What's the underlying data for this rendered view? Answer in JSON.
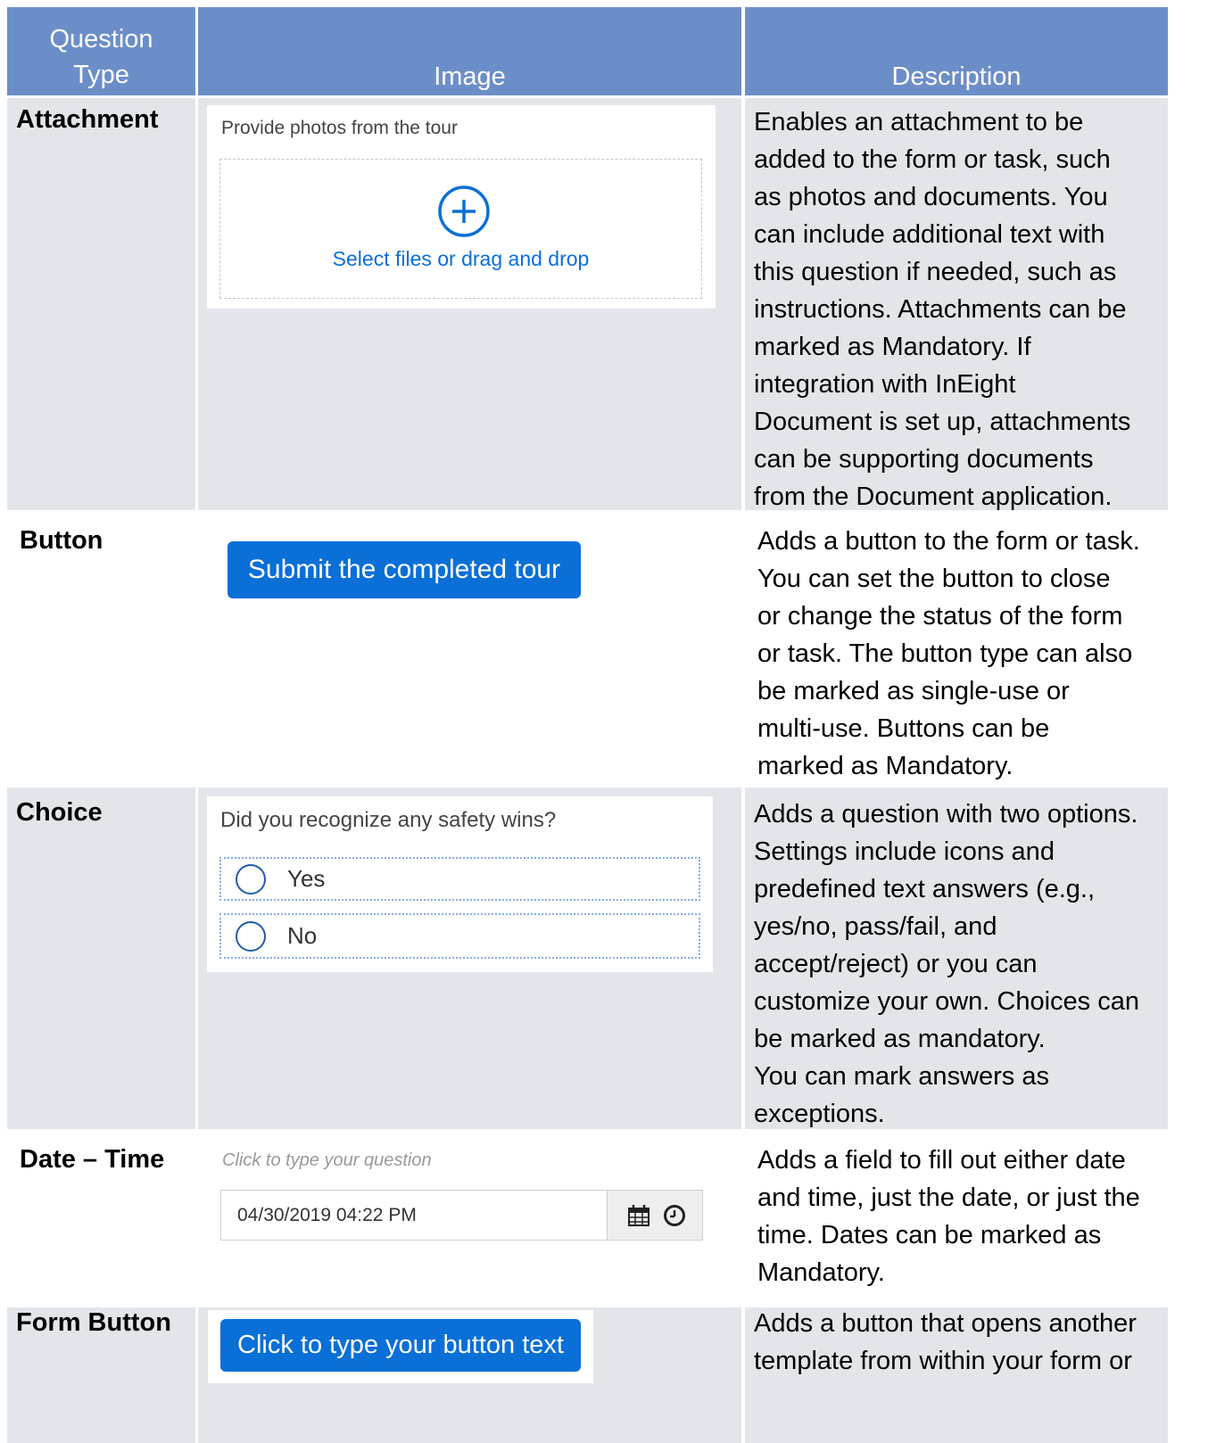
{
  "headers": {
    "question_type": "Question\nType",
    "image": "Image",
    "description": "Description"
  },
  "rows": [
    {
      "type": "Attachment",
      "description": "Enables an attachment to be\nadded to the form or task, such\nas photos and documents. You\ncan include additional text with\nthis question if needed, such as\ninstructions. Attachments can be\nmarked as Mandatory. If\nintegration with InEight\nDocument is set up, attachments\ncan be supporting documents\nfrom the Document application."
    },
    {
      "type": "Button",
      "description": "Adds a button to the form or task.\nYou can set the button to close\nor change the status of the form\nor task. The button type can also\nbe marked as single-use or\nmulti-use. Buttons can be\nmarked as Mandatory."
    },
    {
      "type": "Choice",
      "description": "Adds a question with two options.\nSettings include icons and\npredefined text answers (e.g.,\nyes/no, pass/fail, and\naccept/reject) or you can\ncustomize your own. Choices can\nbe marked as mandatory.\nYou can mark answers as\nexceptions."
    },
    {
      "type": "Date – Time",
      "description": "Adds a field to fill out either date\nand time, just the date, or just the\ntime. Dates can be marked as\nMandatory."
    },
    {
      "type": "Form Button",
      "description": "Adds a button that opens another\ntemplate from within your form or"
    }
  ],
  "attachment_widget": {
    "prompt": "Provide photos from the tour",
    "action": "Select files or drag and drop",
    "icon": "plus-circle-icon"
  },
  "button_widget": {
    "label": "Submit the completed tour"
  },
  "choice_widget": {
    "question": "Did you recognize any safety wins?",
    "options": [
      "Yes",
      "No"
    ]
  },
  "datetime_widget": {
    "placeholder": "Click to type your question",
    "value": "04/30/2019 04:22 PM",
    "icons": [
      "calendar-icon",
      "clock-icon"
    ]
  },
  "form_button_widget": {
    "label": "Click to type your button text"
  },
  "colors": {
    "header": "#6c8ec8",
    "row_gray": "#e2e6ea",
    "accent_blue": "#0a6fd6"
  }
}
